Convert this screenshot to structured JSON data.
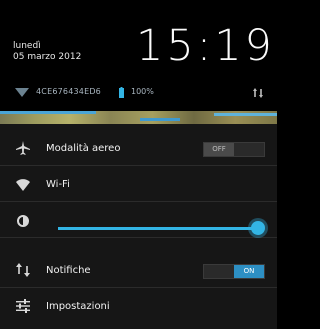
{
  "header": {
    "day": "lunedì",
    "date": "05 marzo 2012",
    "time": "15:19"
  },
  "status": {
    "device_id": "4CE676434ED6",
    "battery": "100%"
  },
  "quick_settings": {
    "airplane": {
      "label": "Modalità aereo",
      "state": "OFF"
    },
    "wifi": {
      "label": "Wi-Fi"
    },
    "brightness": {
      "level": 1.0
    },
    "notifications": {
      "label": "Notifiche",
      "state": "ON"
    },
    "settings": {
      "label": "Impostazioni"
    }
  },
  "colors": {
    "accent": "#33b5e5",
    "panel": "#161616"
  }
}
